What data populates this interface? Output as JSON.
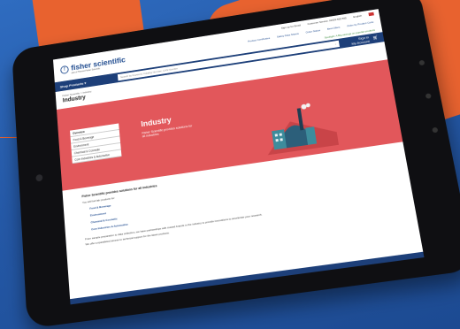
{
  "topbar": {
    "signup": "Sign up for Email",
    "customer_service": "Customer Service: 01509 555 555",
    "language": "English"
  },
  "logo": {
    "name": "fisher scientific",
    "tagline": "part of Thermo Fisher Scientific"
  },
  "links": [
    "Product Certificates",
    "Safety Data Sheets",
    "Order Status",
    "Best Offers",
    "Order by Product Code"
  ],
  "promo": "Spotlight: A Big savings on popular products",
  "navbar": {
    "shop_products": "Shop Products",
    "search_placeholder": "Search by Keyword, Catalog Number, CAS Number",
    "sign_in": "Sign in",
    "my_account": "My Account"
  },
  "breadcrumb": "Fisher Scientific  >  Industry",
  "page_title": "Industry",
  "hero": {
    "title": "Industry",
    "subtitle": "Fisher Scientific provides solutions for all industries"
  },
  "sidebar": {
    "items": [
      {
        "label": "Overview"
      },
      {
        "label": "Food & Beverage"
      },
      {
        "label": "Environment"
      },
      {
        "label": "Chemical & Cosmetic"
      },
      {
        "label": "Core Industries & Automotive"
      }
    ]
  },
  "body": {
    "heading": "Fisher Scientific provides solutions for all industries",
    "intro": "You will find lab products for:",
    "list": [
      "Food & Beverage",
      "Environment",
      "Chemical & Cosmetic",
      "Core Industries & Automotive"
    ],
    "closing": "From sample preparation to data collection, we have partnerships with trusted brands in the industry to provide innovations to accelerate your research.",
    "closing2": "We offer unparalleled access to technical support for the latest products."
  },
  "colors": {
    "brand_blue": "#1d3f79",
    "hero_red": "#e2575b",
    "background_blue": "#2458a6",
    "accent_orange": "#e8622f"
  }
}
